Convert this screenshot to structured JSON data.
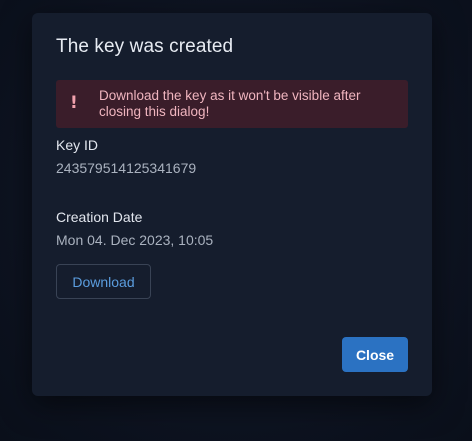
{
  "dialog": {
    "title": "The key was created",
    "alert": {
      "icon": "exclamation-icon",
      "message": "Download the key as it won't be visible after closing this dialog!"
    },
    "key_id": {
      "label": "Key ID",
      "value": "243579514125341679"
    },
    "creation_date": {
      "label": "Creation Date",
      "value": "Mon 04. Dec 2023, 10:05"
    },
    "download_label": "Download",
    "close_label": "Close"
  },
  "colors": {
    "accent": "#2b72c2",
    "alert_bg": "#3a1d2a",
    "alert_text": "#f0b5bf",
    "link": "#5b9dde"
  }
}
